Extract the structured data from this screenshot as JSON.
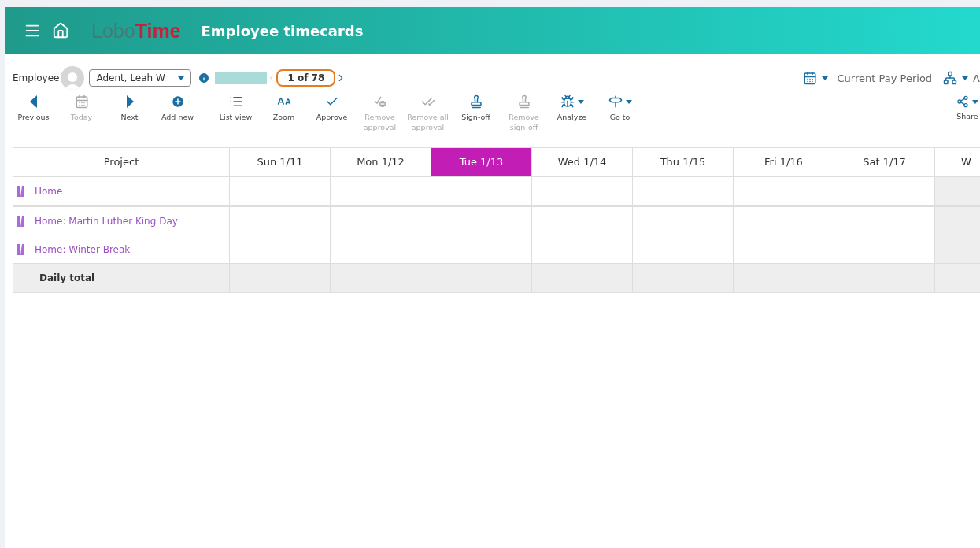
{
  "header": {
    "logo": {
      "first": "Lobo",
      "second": "Time"
    },
    "title": "Employee timecards"
  },
  "employee_bar": {
    "label": "Employee",
    "employee": "Adent, Leah W",
    "pager": "1 of 78",
    "period": "Current Pay Period",
    "cut_label": "A"
  },
  "toolbar": [
    {
      "kind": "prev",
      "label": "Previous",
      "disabled": false
    },
    {
      "kind": "today",
      "label": "Today",
      "disabled": true
    },
    {
      "kind": "next",
      "label": "Next",
      "disabled": false
    },
    {
      "kind": "add",
      "label": "Add new",
      "disabled": false
    },
    {
      "kind": "list",
      "label": "List view",
      "disabled": false
    },
    {
      "kind": "zoom",
      "label": "Zoom",
      "disabled": false
    },
    {
      "kind": "check",
      "label": "Approve",
      "disabled": false
    },
    {
      "kind": "uncheck",
      "label": "Remove approval",
      "disabled": true
    },
    {
      "kind": "uncheckall",
      "label": "Remove all approval",
      "disabled": true
    },
    {
      "kind": "stamp",
      "label": "Sign-off",
      "disabled": false
    },
    {
      "kind": "unstamp",
      "label": "Remove sign-off",
      "disabled": true
    },
    {
      "kind": "analyze",
      "label": "Analyze",
      "disabled": false,
      "menu": true
    },
    {
      "kind": "goto",
      "label": "Go to",
      "disabled": false,
      "menu": true
    }
  ],
  "share": {
    "label": "Share"
  },
  "table": {
    "columns": [
      {
        "label": "Project",
        "selected": false
      },
      {
        "label": "Sun 1/11",
        "selected": false
      },
      {
        "label": "Mon 1/12",
        "selected": false
      },
      {
        "label": "Tue 1/13",
        "selected": true
      },
      {
        "label": "Wed 1/14",
        "selected": false
      },
      {
        "label": "Thu 1/15",
        "selected": false
      },
      {
        "label": "Fri 1/16",
        "selected": false
      },
      {
        "label": "Sat 1/17",
        "selected": false
      },
      {
        "label": "W",
        "selected": false
      }
    ],
    "rows": [
      {
        "kind": "project",
        "label": "Home"
      },
      {
        "kind": "project",
        "label": "Home: Martin Luther King Day"
      },
      {
        "kind": "project",
        "label": "Home: Winter Break"
      },
      {
        "kind": "total",
        "label": "Daily total"
      }
    ]
  }
}
